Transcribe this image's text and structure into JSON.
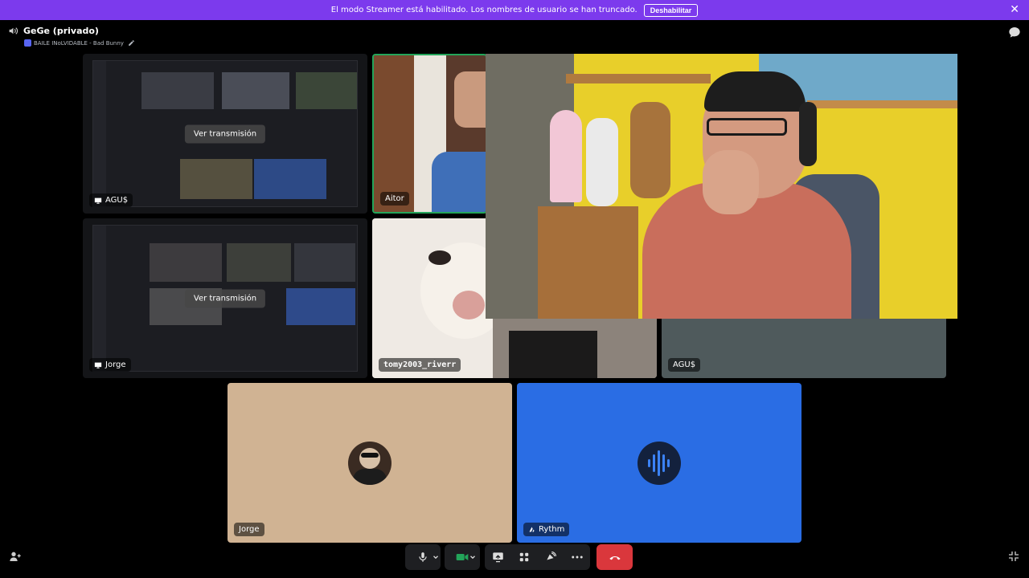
{
  "banner": {
    "message": "El modo Streamer está habilitado. Los nombres de usuario se han truncado.",
    "button_label": "Deshabilitar",
    "close": "✕"
  },
  "channel": {
    "title": "GeGe (privado)",
    "activity": "BAILE INoLVIDABLE - Bad Bunny"
  },
  "tiles": {
    "stream_agu": {
      "label": "AGU$",
      "action": "Ver transmisión"
    },
    "cam_aitor": {
      "label": "Aitor"
    },
    "stream_jorge": {
      "label": "Jorge",
      "action": "Ver transmisión"
    },
    "cam_tomy": {
      "label": "tomy2003_riverr"
    },
    "cam_agu": {
      "label": "AGU$"
    },
    "user_jorge": {
      "label": "Jorge"
    },
    "bot_rythm": {
      "label": "Rythm"
    }
  },
  "colors": {
    "banner": "#7c3aed",
    "jorge_tile": "#d0b393",
    "rythm_tile": "#2a6de4",
    "agu_tile": "#4f5a5c",
    "hangup": "#da373c",
    "active_camera": "#23a55a"
  },
  "icons": [
    "speaker-icon",
    "pencil-icon",
    "chat-icon",
    "stream-icon",
    "microphone-icon",
    "camera-icon",
    "screen-share-icon",
    "activities-icon",
    "soundboard-icon",
    "more-icon",
    "hangup-icon",
    "invite-icon",
    "exit-fullscreen-icon",
    "bot-icon"
  ]
}
